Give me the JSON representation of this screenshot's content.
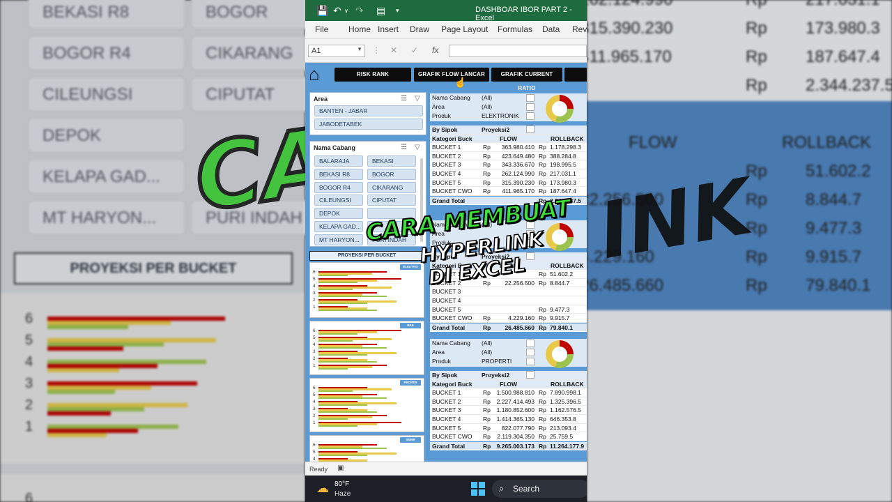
{
  "window": {
    "title": "DASHBOAR IBOR PART 2",
    "app": "Excel"
  },
  "ribbon_tabs": [
    "File",
    "Home",
    "Insert",
    "Draw",
    "Page Layout",
    "Formulas",
    "Data",
    "Revi"
  ],
  "namebox": "A1",
  "nav_buttons": [
    "RISK RANK",
    "GRAFIK FLOW LANCAR",
    "GRAFIK CURRENT RATIO"
  ],
  "slicer_area": {
    "header": "Area",
    "items": [
      "BANTEN - JABAR",
      "JABODETABEK"
    ]
  },
  "slicer_cabang": {
    "header": "Nama Cabang",
    "items": [
      "BALARAJA",
      "BEKASI",
      "BEKASI R8",
      "BOGOR",
      "BOGOR R4",
      "CIKARANG",
      "CILEUNGSI",
      "CIPUTAT",
      "DEPOK",
      "",
      "KELAPA GAD...",
      "",
      "MT HARYON...",
      "PURI INDAH"
    ]
  },
  "projection_title": "PROYEKSI PER BUCKET",
  "mini_charts": [
    {
      "tag": "ELEKTRO",
      "ticks": [
        "6",
        "5",
        "4",
        "3",
        "2",
        "1"
      ]
    },
    {
      "tag": "BKE",
      "ticks": [
        "6",
        "5",
        "4",
        "3",
        "2",
        "1"
      ]
    },
    {
      "tag": "PROPER",
      "ticks": [
        "6",
        "5",
        "4",
        "3",
        "2",
        "1"
      ]
    },
    {
      "tag": "SMBB",
      "ticks": [
        "6",
        "5",
        "4"
      ]
    }
  ],
  "filter_labels": [
    "Nama Cabang",
    "Area",
    "Produk"
  ],
  "pivot_headers": {
    "by": "By Sipok",
    "proj": "Proyeksi2",
    "kat": "Kategori Buck",
    "flow": "FLOW",
    "rollback": "ROLLBACK",
    "total": "Grand Total",
    "rp": "Rp"
  },
  "pivot1": {
    "filters": [
      "(All)",
      "(All)",
      "ELEKTRONIK"
    ],
    "rows": [
      [
        "BUCKET 1",
        "363.980.410",
        "1.178.298.3"
      ],
      [
        "BUCKET 2",
        "423.649.480",
        "388.284.8"
      ],
      [
        "BUCKET 3",
        "343.336.670",
        "198.995.5"
      ],
      [
        "BUCKET 4",
        "262.124.990",
        "217.031.1"
      ],
      [
        "BUCKET 5",
        "315.390.230",
        "173.980.3"
      ],
      [
        "BUCKET CWO",
        "411.965.170",
        "187.647.4"
      ]
    ],
    "total": [
      "",
      "2.344.237.5"
    ]
  },
  "pivot2": {
    "filters": [
      "(All)",
      "",
      ""
    ],
    "rows": [
      [
        "BUCKET 1",
        "",
        "51.602.2"
      ],
      [
        "BUCKET 2",
        "22.256.500",
        "8.844.7"
      ],
      [
        "BUCKET 3",
        "",
        ""
      ],
      [
        "BUCKET 4",
        "",
        ""
      ],
      [
        "BUCKET 5",
        "",
        "9.477.3"
      ],
      [
        "BUCKET CWO",
        "4.229.160",
        "9.915.7"
      ]
    ],
    "total": [
      "26.485.660",
      "79.840.1"
    ]
  },
  "pivot3": {
    "filters": [
      "(All)",
      "(All)",
      "PROPERTI"
    ],
    "rows": [
      [
        "BUCKET 1",
        "1.500.988.810",
        "7.890.998.1"
      ],
      [
        "BUCKET 2",
        "2.227.414.493",
        "1.325.396.5"
      ],
      [
        "BUCKET 3",
        "1.180.852.600",
        "1.162.576.5"
      ],
      [
        "BUCKET 4",
        "1.414.365.130",
        "646.353.8"
      ],
      [
        "BUCKET 5",
        "822.077.790",
        "213.093.4"
      ],
      [
        "BUCKET CWO",
        "2.119.304.350",
        "25.759.5"
      ]
    ],
    "total": [
      "9.265.003.173",
      "11.264.177.9"
    ]
  },
  "status": "Ready",
  "weather": {
    "temp": "80°F",
    "cond": "Haze"
  },
  "search_label": "Search",
  "overlay": {
    "line1": "CARA MEMBUAT",
    "line2": "HYPERLINK",
    "line3": "DI EXCEL"
  },
  "background": {
    "left_pills": [
      [
        "BEKASI R8",
        "BOGOR"
      ],
      [
        "BOGOR R4",
        "CIKARANG"
      ],
      [
        "CILEUNGSI",
        "CIPUTAT"
      ],
      [
        "DEPOK",
        ""
      ],
      [
        "KELAPA GAD...",
        ""
      ],
      [
        "MT HARYON...",
        "PURI INDAH"
      ]
    ],
    "title": "PROYEKSI PER BUCKET",
    "ticks": [
      "6",
      "5",
      "4",
      "3",
      "2",
      "1",
      "6"
    ],
    "big_left_text": "CAR",
    "big_right_text": "INK",
    "right_rows": [
      [
        "262.124.990",
        "Rp",
        "217.031.1"
      ],
      [
        "315.390.230",
        "Rp",
        "173.980.3"
      ],
      [
        "411.965.170",
        "Rp",
        "187.647.4"
      ],
      [
        "",
        "Rp",
        "2.344.237.5"
      ],
      [
        "",
        "",
        ""
      ],
      [
        "FLOW",
        "",
        "ROLLBACK"
      ],
      [
        "",
        "Rp",
        "51.602.2"
      ],
      [
        "22.256.500",
        "Rp",
        "8.844.7"
      ],
      [
        "",
        "Rp",
        "9.477.3"
      ],
      [
        "4.229.160",
        "Rp",
        "9.915.7"
      ],
      [
        "26.485.660",
        "Rp",
        "79.840.1"
      ]
    ]
  },
  "colors": {
    "excel_green": "#1d6b3e",
    "sheet_blue": "#5b9bd5",
    "bar_red": "#c00000",
    "bar_yellow": "#e8c94a",
    "bar_green": "#9dc34f"
  }
}
